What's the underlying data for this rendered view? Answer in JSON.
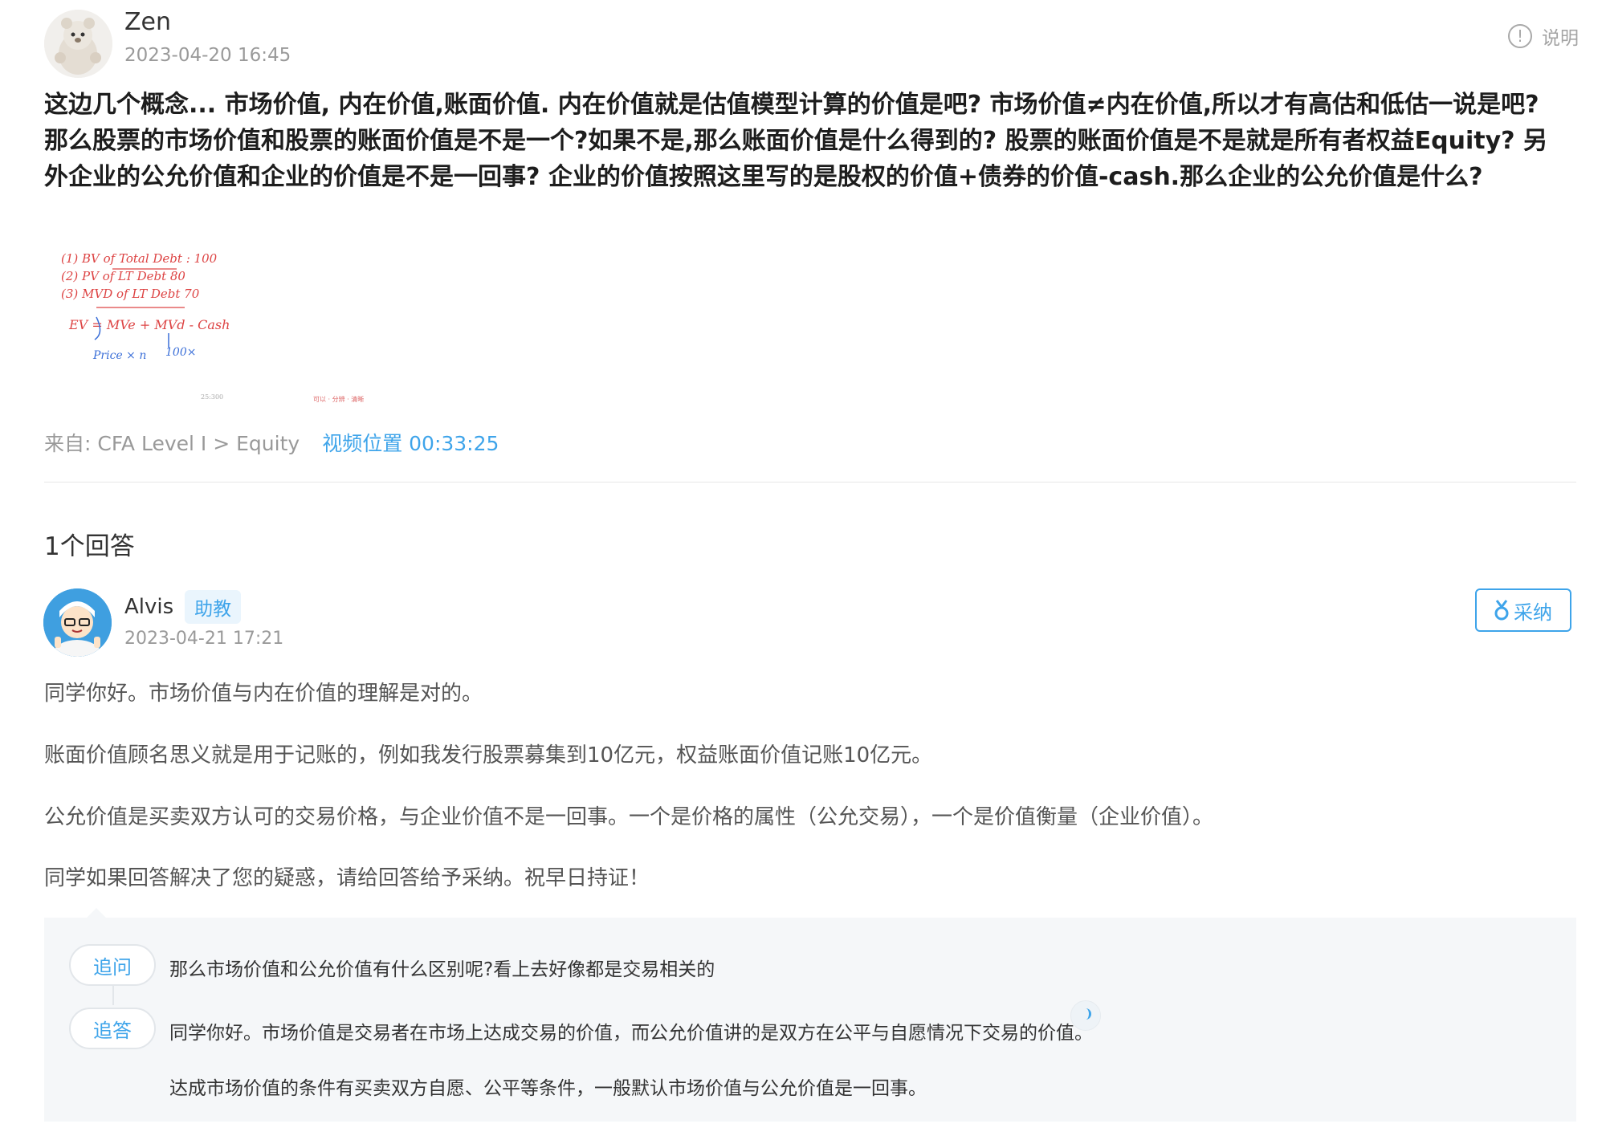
{
  "question": {
    "user_name": "Zen",
    "time": "2023-04-20 16:45",
    "explain_label": "说明",
    "text": "这边几个概念... 市场价值, 内在价值,账面价值. 内在价值就是估值模型计算的价值是吧? 市场价值≠内在价值,所以才有高估和低估一说是吧? 那么股票的市场价值和股票的账面价值是不是一个?如果不是,那么账面价值是什么得到的? 股票的账面价值是不是就是所有者权益Equity? 另外企业的公允价值和企业的价值是不是一回事? 企业的价值按照这里写的是股权的价值+债券的价值-cash.那么企业的公允价值是什么?",
    "source_prefix": "来自:",
    "source_path": "CFA Level I > Equity",
    "video_position": "视频位置 00:33:25",
    "sketch": {
      "line1": "(1) BV of Total Debt : 100",
      "line2": "(2) PV of LT Debt   80",
      "line3": "(3) MVD of LT Debt  70",
      "line4": "EV = MVe + MVd - Cash",
      "line5": "Price × n",
      "line6": "100×",
      "foot_left": "25:300",
      "foot_right": "可以 · 分辨 · 清晰"
    }
  },
  "answers_count": "1个回答",
  "answer": {
    "user_name": "Alvis",
    "badge": "助教",
    "time": "2023-04-21 17:21",
    "accept_label": "采纳",
    "paragraphs": [
      "同学你好。市场价值与内在价值的理解是对的。",
      "账面价值顾名思义就是用于记账的，例如我发行股票募集到10亿元，权益账面价值记账10亿元。",
      "公允价值是买卖双方认可的交易价格，与企业价值不是一回事。一个是价格的属性（公允交易），一个是价值衡量（企业价值）。",
      "同学如果回答解决了您的疑惑，请给回答给予采纳。祝早日持证！"
    ]
  },
  "followups": [
    {
      "label": "追问",
      "text": "那么市场价值和公允价值有什么区别呢?看上去好像都是交易相关的"
    },
    {
      "label": "追答",
      "text": "同学你好。市场价值是交易者在市场上达成交易的价值，而公允价值讲的是双方在公平与自愿情况下交易的价值。",
      "text2": "达成市场价值的条件有买卖双方自愿、公平等条件，一般默认市场价值与公允价值是一回事。"
    }
  ],
  "colors": {
    "accent": "#3ea4ea",
    "muted": "#999999",
    "panel": "#f5f7f9"
  }
}
